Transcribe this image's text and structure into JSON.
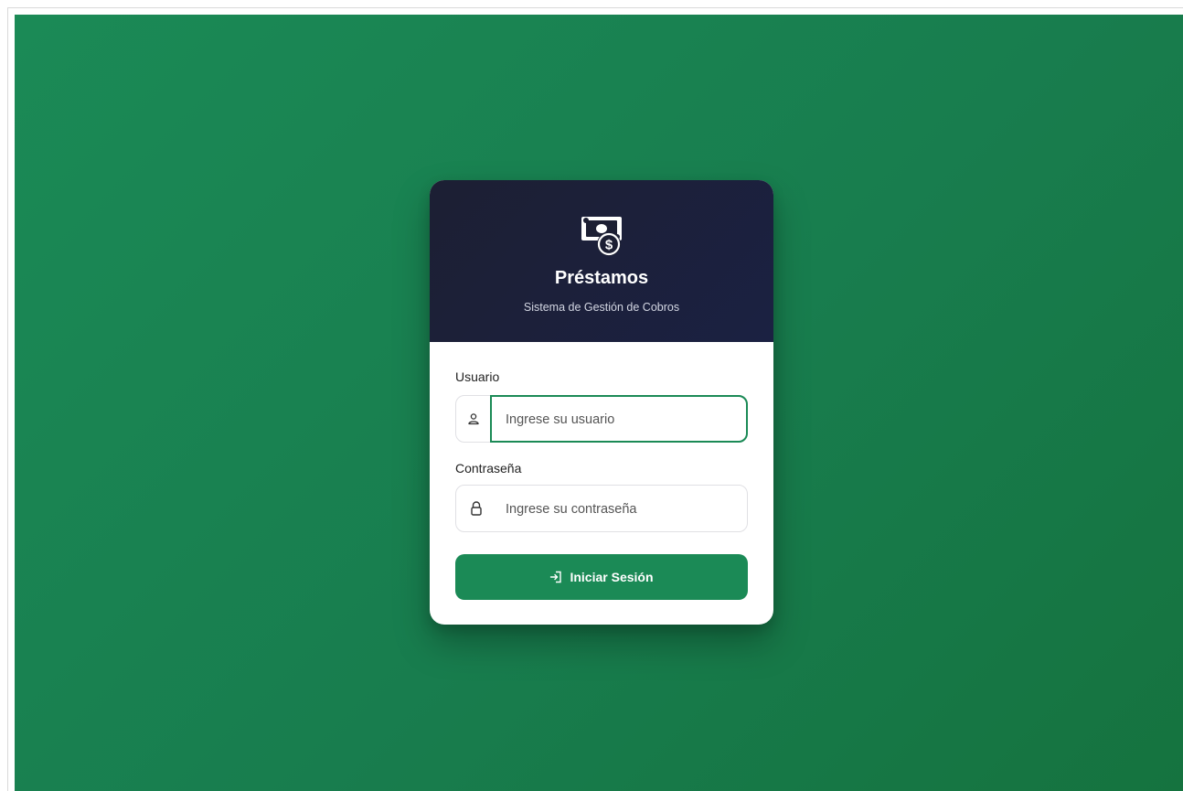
{
  "brand": {
    "title": "Préstamos",
    "subtitle": "Sistema de Gestión de Cobros",
    "icon": "money-bill-dollar-icon"
  },
  "form": {
    "username": {
      "label": "Usuario",
      "placeholder": "Ingrese su usuario",
      "value": "",
      "icon": "user-icon"
    },
    "password": {
      "label": "Contraseña",
      "placeholder": "Ingrese su contraseña",
      "value": "",
      "icon": "lock-icon"
    },
    "submit": {
      "label": "Iniciar Sesión",
      "icon": "sign-in-icon"
    }
  },
  "colors": {
    "background": "#1b8a56",
    "header": "#1c1f33",
    "accent": "#1b8a56"
  }
}
